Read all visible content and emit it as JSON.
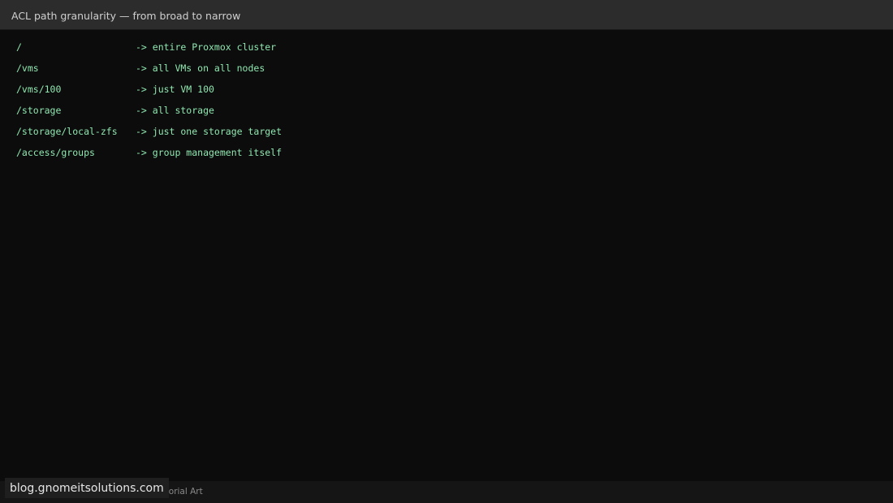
{
  "window": {
    "title": "ACL path granularity — from broad to narrow"
  },
  "terminal": {
    "lines": [
      {
        "path": "/",
        "desc": "-> entire Proxmox cluster"
      },
      {
        "path": "/vms",
        "desc": "-> all VMs on all nodes"
      },
      {
        "path": "/vms/100",
        "desc": "-> just VM 100"
      },
      {
        "path": "/storage",
        "desc": "-> all storage"
      },
      {
        "path": "/storage/local-zfs",
        "desc": "-> just one storage target"
      },
      {
        "path": "/access/groups",
        "desc": "-> group management itself"
      }
    ]
  },
  "statusbar": {
    "text": "utorial Art"
  },
  "watermark": {
    "text": "blog.gnomeitsolutions.com"
  },
  "colors": {
    "terminal_text": "#8fe6b0",
    "background": "#0c0c0c",
    "titlebar": "#2c2c2c"
  }
}
